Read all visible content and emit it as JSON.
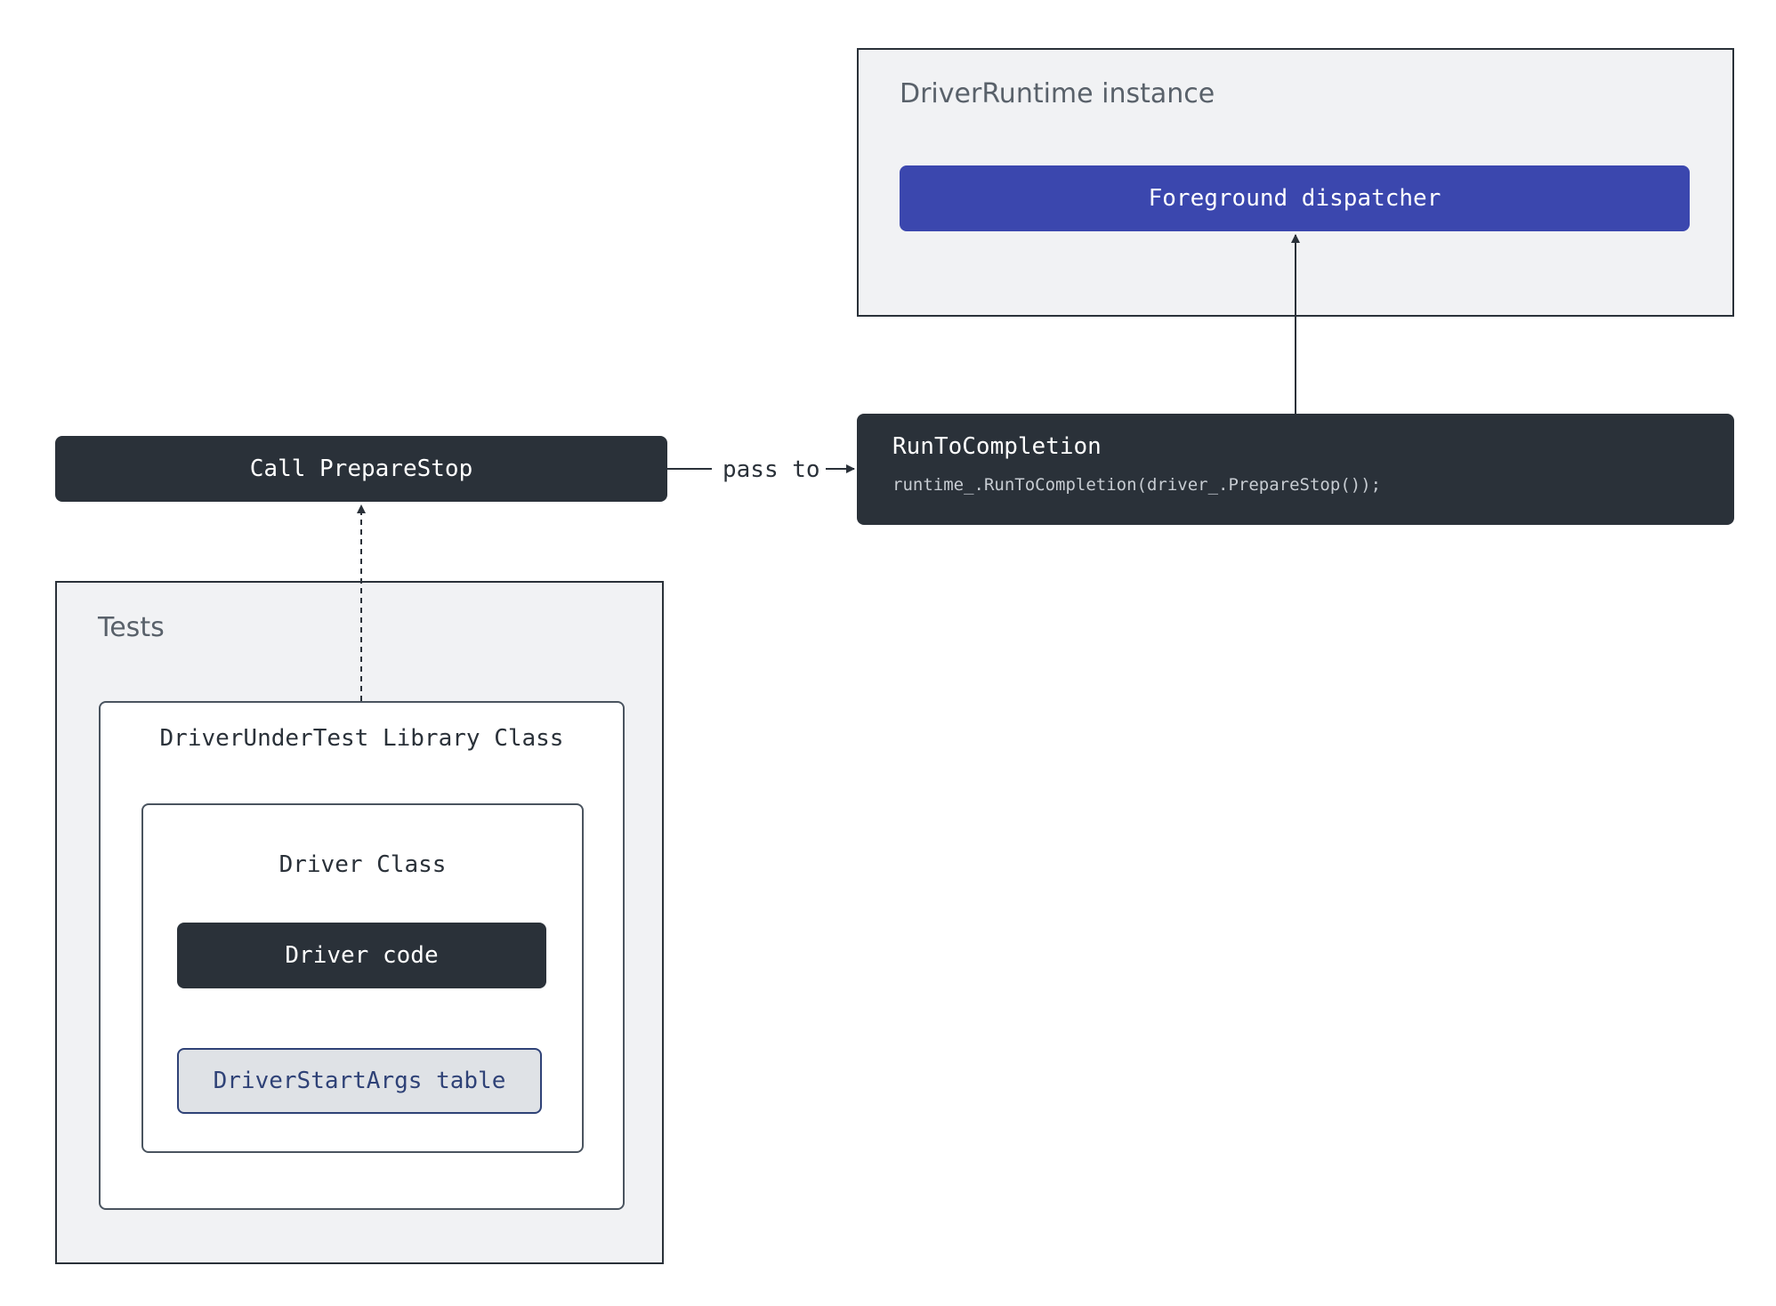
{
  "runtime": {
    "label": "DriverRuntime instance",
    "dispatcher": "Foreground dispatcher"
  },
  "run_to_completion": {
    "title": "RunToCompletion",
    "code": "runtime_.RunToCompletion(driver_.PrepareStop());"
  },
  "prepare_stop": {
    "label": "Call PrepareStop"
  },
  "edge": {
    "pass_to": "pass to"
  },
  "tests": {
    "label": "Tests",
    "library_class": "DriverUnderTest Library Class",
    "driver_class": "Driver Class",
    "driver_code": "Driver code",
    "start_args": "DriverStartArgs table"
  },
  "colors": {
    "dark": "#2a3139",
    "blue": "#3b47ae",
    "group_bg": "#f1f2f4",
    "table_bg": "#dfe2e6",
    "table_text": "#2f4277"
  }
}
